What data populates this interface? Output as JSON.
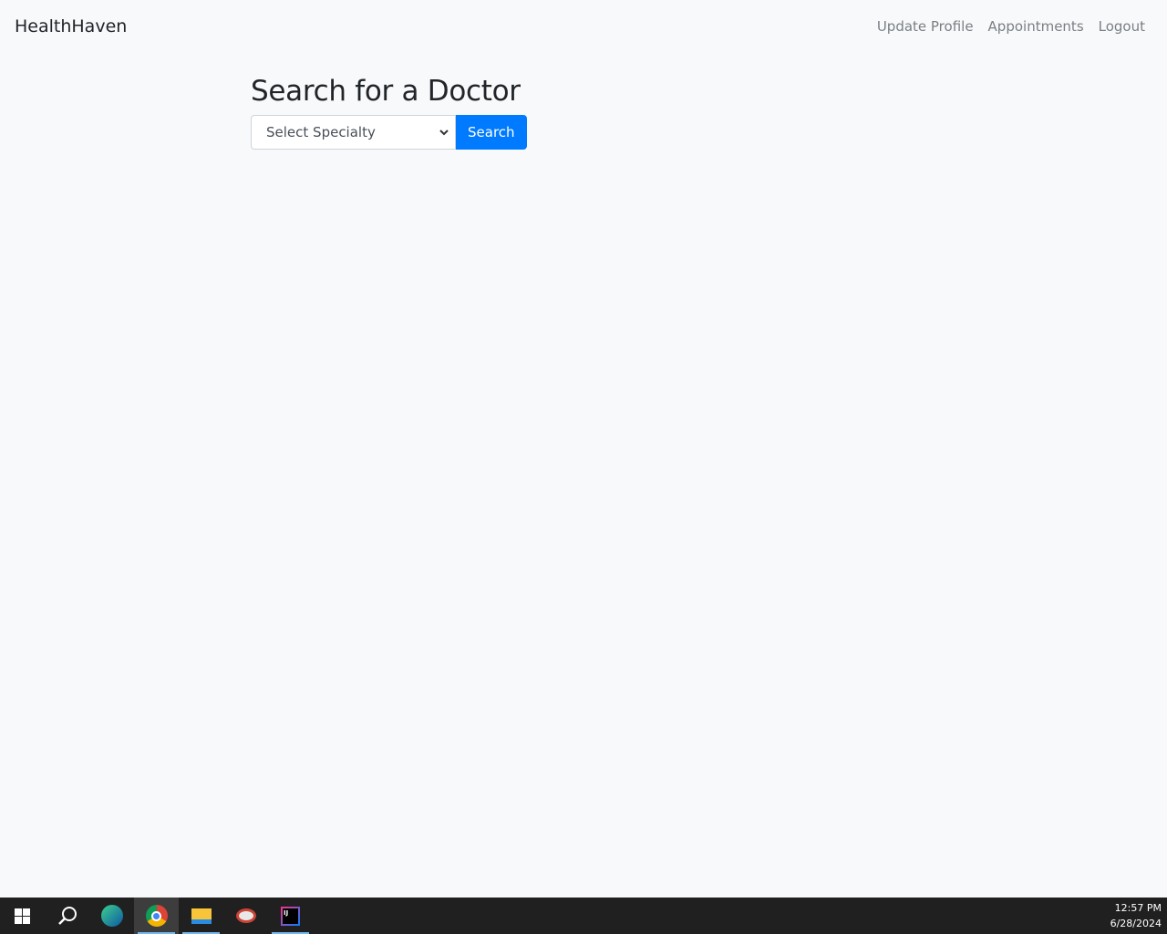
{
  "navbar": {
    "brand": "HealthHaven",
    "links": [
      "Update Profile",
      "Appointments",
      "Logout"
    ]
  },
  "main": {
    "title": "Search for a Doctor",
    "specialty_select": {
      "selected": "Select Specialty"
    },
    "search_label": "Search",
    "accent": "#007bff"
  },
  "taskbar": {
    "apps": [
      "windows-start-icon",
      "search-icon",
      "edge-icon",
      "chrome-icon",
      "file-explorer-icon",
      "snipping-tool-icon",
      "intellij-icon"
    ],
    "time": "12:57 PM",
    "date": "6/28/2024"
  }
}
